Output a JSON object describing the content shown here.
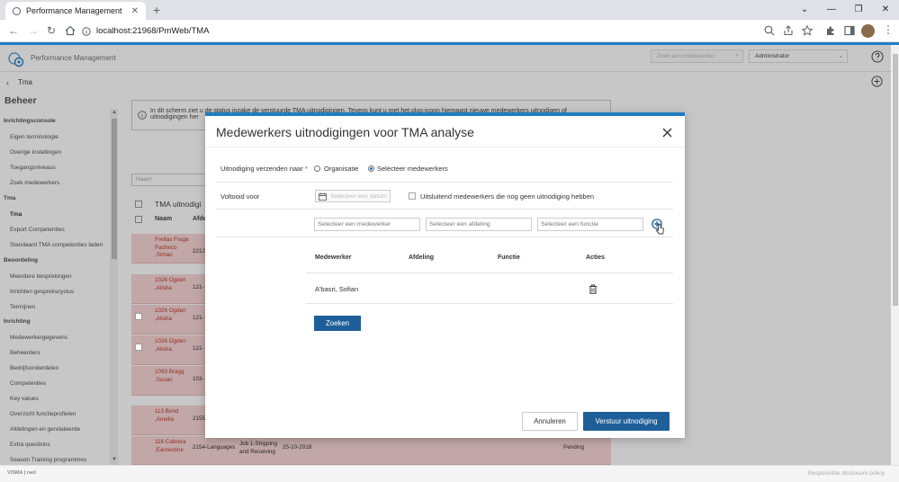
{
  "browser": {
    "tab_title": "Performance Management",
    "tab_close": "✕",
    "new_tab": "+",
    "url": "localhost:21968/PmWeb/TMA"
  },
  "app": {
    "title": "Performance Management",
    "search_placeholder": "Zoek een medewerker",
    "admin_select": "Administrator",
    "breadcrumb": "Tma"
  },
  "sidebar": {
    "heading": "Beheer",
    "groups": [
      {
        "label": "Inrichtingsconsole",
        "items": [
          "Eigen terminologie",
          "Overige instellingen",
          "Toegangsniveaus",
          "Zoek medewerkers"
        ]
      },
      {
        "label": "Tma",
        "items": [
          "Tma",
          "Export Competenties",
          "Standaard TMA competenties laden"
        ]
      },
      {
        "label": "Beoordeling",
        "items": [
          "Meerdere besprekingen",
          "Inrichten gesprekscyclus",
          "Termijnen"
        ]
      },
      {
        "label": "Inrichting",
        "items": [
          "Medewerkergegevens",
          "Beheerders",
          "Bedrijfsonderdelen",
          "Competenties",
          "Key values",
          "Overzicht functieprofielen",
          "Afdelingen en gerelateerde",
          "Extra questions",
          "Season Training programmes"
        ]
      }
    ]
  },
  "background": {
    "info_text": "In dit scherm ziet u de status inzake de verstuurde TMA uitnodigingen. Tevens kunt u met het plus-icoon hiernaast nieuwe medewerkers uitnodigen of uitnodigingen her",
    "naam_placeholder": "Naam",
    "table_title": "TMA uitnodigi",
    "col_naam": "Naam",
    "col_afd": "Afdel",
    "rows": [
      {
        "name": "Freitas Fraga Pacheco ,Simao",
        "code": "2212",
        "extra": "",
        "date": "",
        "status": ""
      },
      {
        "name": "1026 Ogden ,Alisha",
        "code": "121-",
        "extra": "",
        "date": "",
        "status": ""
      },
      {
        "name": "1026 Ogden ,Alisha",
        "code": "121-",
        "extra": "",
        "date": "",
        "status": ""
      },
      {
        "name": "1026 Ogden ,Alisha",
        "code": "121-",
        "extra": "",
        "date": "",
        "status": ""
      },
      {
        "name": "1093 Bragg ,Susan",
        "code": "103-",
        "extra": "",
        "date": "",
        "status": ""
      },
      {
        "name": "113 Bond ,Amelia",
        "code": "2155",
        "extra": "",
        "date": "",
        "status": ""
      },
      {
        "name": "116 Cabrera ,Earnestine",
        "code": "2154-Languages",
        "extra": "Job 1-Shipping and Receiving",
        "date": "25-10-2018",
        "status": "Pending"
      }
    ]
  },
  "modal": {
    "title": "Medewerkers uitnodigingen voor TMA analyse",
    "send_to_label": "Uitnodiging verzenden naar",
    "required_mark": "*",
    "radio_org": "Organisatie",
    "radio_sel": "Selecteer medewerkers",
    "radio_selected": "Selecteer medewerkers",
    "completed_label": "Voltooid voor",
    "date_placeholder": "Selecteer een datum",
    "only_uninvited_label": "Uitsluitend medewerkers die nog geen uitnodiging hebben",
    "only_uninvited_checked": false,
    "filters": {
      "employee_placeholder": "Selecteer een medewerker",
      "department_placeholder": "Selecteer een afdeling",
      "function_placeholder": "Selecteer een functie"
    },
    "table": {
      "headers": [
        "Medewerker",
        "Afdeling",
        "Functie",
        "Acties"
      ],
      "rows": [
        {
          "medewerker": "A'basri, Sofian",
          "afdeling": "",
          "functie": ""
        }
      ]
    },
    "search_button": "Zoeken",
    "cancel_button": "Annuleren",
    "send_button": "Verstuur uitnodiging"
  },
  "statusbar": {
    "left": "VISMA | raet",
    "right": "Responsible disclosure policy"
  },
  "colors": {
    "accent": "#1f7ec1",
    "primary_button": "#1f5f99",
    "row_highlight": "#f8d7d7",
    "link_red": "#c0392b"
  }
}
